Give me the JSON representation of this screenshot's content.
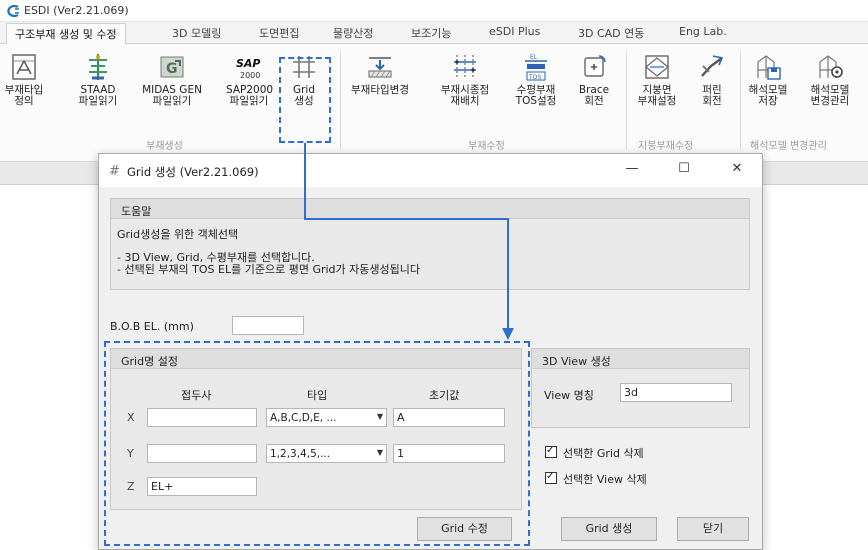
{
  "app": {
    "title": "ESDI (Ver2.21.069)",
    "accent_color": "#1b75bb"
  },
  "tabs": [
    {
      "label": "구조부재 생성 및 수정",
      "active": true
    },
    {
      "label": "3D 모델링"
    },
    {
      "label": "도면편집"
    },
    {
      "label": "물량산정"
    },
    {
      "label": "보조기능"
    },
    {
      "label": "eSDI Plus"
    },
    {
      "label": "3D CAD 연동"
    },
    {
      "label": "Eng Lab."
    }
  ],
  "ribbon": {
    "buttons": [
      {
        "label": "부재타입\n정의",
        "icon": "member-type-define-icon"
      },
      {
        "label": "STAAD\n파일읽기",
        "icon": "staad-file-icon"
      },
      {
        "label": "MIDAS GEN\n파일읽기",
        "icon": "midas-gen-file-icon"
      },
      {
        "label": "SAP2000\n파일읽기",
        "icon": "sap2000-file-icon",
        "icon_text": "SAP",
        "icon_sub": "2000"
      },
      {
        "label": "Grid\n생성",
        "icon": "grid-create-icon"
      },
      {
        "label": "부재타입변경",
        "icon": "member-type-change-icon"
      },
      {
        "label": "부재시종점\n재배치",
        "icon": "member-reposition-icon"
      },
      {
        "label": "수평부재\nTOS설정",
        "icon": "tos-set-icon",
        "icon_el": "EL",
        "icon_tos": "TOS"
      },
      {
        "label": "Brace\n회전",
        "icon": "brace-rotate-icon"
      },
      {
        "label": "지붕면\n부재설정",
        "icon": "roof-member-icon"
      },
      {
        "label": "퍼린\n회전",
        "icon": "purlin-rotate-icon"
      },
      {
        "label": "해석모델\n저장",
        "icon": "analysis-model-save-icon"
      },
      {
        "label": "해석모델\n변경관리",
        "icon": "analysis-model-manage-icon"
      }
    ],
    "groups": [
      "부재생성",
      "부재수정",
      "지붕부재수정",
      "해석모델 변경관리"
    ]
  },
  "dialog": {
    "title": "Grid 생성 (Ver2.21.069)",
    "title_icon": "grid-icon",
    "controls": {
      "minimize": "—",
      "maximize": "☐",
      "close": "✕"
    },
    "help": {
      "heading": "도움말",
      "subheading": "Grid생성을 위한 객체선택",
      "lines": [
        "- 3D View, Grid, 수평부재를 선택합니다.",
        "- 선택된 부재의 TOS EL를 기준으로 평면 Grid가 자동생성됩니다"
      ]
    },
    "bob": {
      "label": "B.O.B EL. (mm)",
      "value": ""
    },
    "grid_names": {
      "title": "Grid명 설정",
      "headers": {
        "prefix": "접두사",
        "type": "타입",
        "initial": "초기값"
      },
      "rows": [
        {
          "axis": "X",
          "prefix": "",
          "type": "A,B,C,D,E, ...",
          "initial": "A"
        },
        {
          "axis": "Y",
          "prefix": "",
          "type": "1,2,3,4,5,...",
          "initial": "1"
        },
        {
          "axis": "Z",
          "prefix": "EL+"
        }
      ],
      "modify_button": "Grid 수정"
    },
    "view3d": {
      "title": "3D View 생성",
      "name_label": "View 명칭",
      "name_value": "3d"
    },
    "checkboxes": [
      {
        "label": "선택한 Grid 삭제",
        "checked": true
      },
      {
        "label": "선택한 View 삭제",
        "checked": true
      }
    ],
    "create_button": "Grid 생성",
    "close_button": "닫기"
  },
  "annotation": {
    "color": "#2f6fd1"
  }
}
